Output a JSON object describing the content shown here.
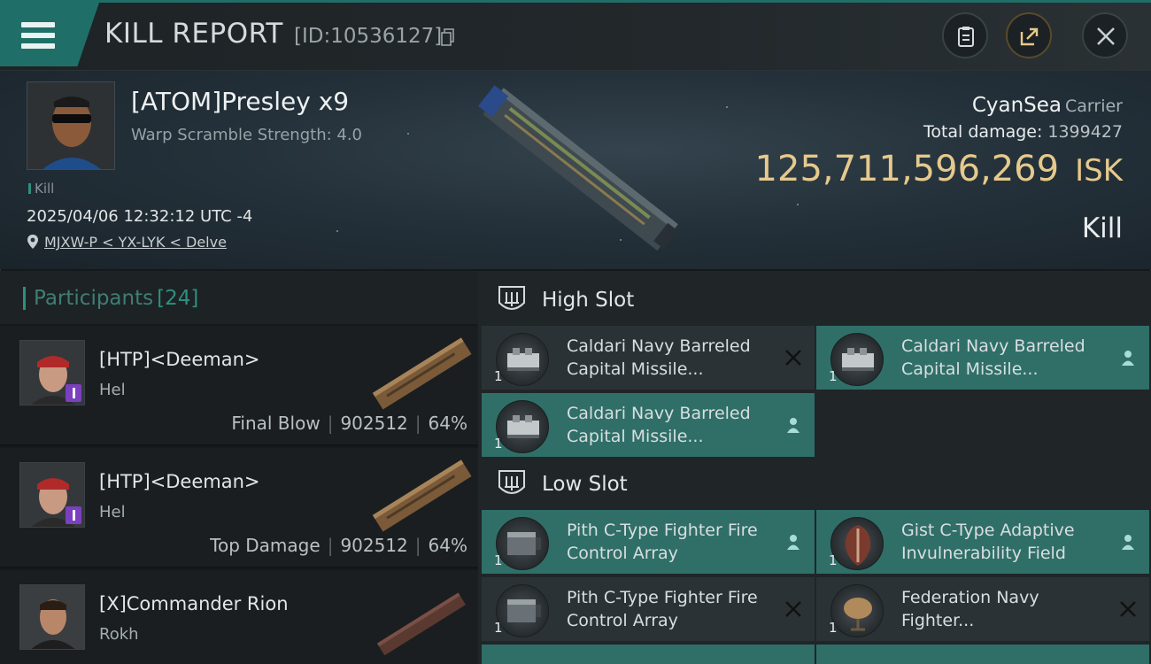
{
  "topbar": {
    "title": "KILL REPORT",
    "report_id": "[ID:10536127]"
  },
  "victim": {
    "name": "[ATOM]Presley x9",
    "warp_scramble": "Warp Scramble Strength: 4.0",
    "tag": "Kill",
    "datetime": "2025/04/06 12:32:12 UTC -4",
    "location": "MJXW-P < YX-LYK < Delve",
    "ship_name": "CyanSea",
    "ship_class": "Carrier",
    "total_damage_label": "Total damage:",
    "total_damage_value": "1399427",
    "isk_value": "125,711,596,269",
    "isk_unit": "ISK",
    "result": "Kill"
  },
  "participants": {
    "title": "Participants",
    "count": "[24]",
    "rows": [
      {
        "name": "[HTP]<Deeman>",
        "ship": "Hel",
        "role": "Final Blow",
        "damage": "902512",
        "percent": "64%"
      },
      {
        "name": "[HTP]<Deeman>",
        "ship": "Hel",
        "role": "Top Damage",
        "damage": "902512",
        "percent": "64%"
      },
      {
        "name": "[X]Commander Rion",
        "ship": "Rokh",
        "role": "",
        "damage": "",
        "percent": ""
      }
    ]
  },
  "slots": {
    "high": {
      "title": "High Slot",
      "modules": [
        {
          "name": "Caldari Navy Barreled Capital Missile...",
          "qty": "1",
          "status": "destroyed"
        },
        {
          "name": "Caldari Navy Barreled Capital Missile...",
          "qty": "1",
          "status": "dropped"
        },
        {
          "name": "Caldari Navy Barreled Capital Missile...",
          "qty": "1",
          "status": "dropped"
        }
      ]
    },
    "low": {
      "title": "Low Slot",
      "modules": [
        {
          "name": "Pith C-Type Fighter Fire Control Array",
          "qty": "1",
          "status": "dropped"
        },
        {
          "name": "Gist C-Type Adaptive Invulnerability Field",
          "qty": "1",
          "status": "dropped"
        },
        {
          "name": "Pith C-Type Fighter Fire Control Array",
          "qty": "1",
          "status": "destroyed"
        },
        {
          "name": "Federation Navy Fighter...",
          "qty": "1",
          "status": "destroyed"
        }
      ]
    }
  },
  "colors": {
    "accent": "#1f6f68",
    "isk": "#e6c98c",
    "dropped_bg": "#2f6f68",
    "destroyed_bg": "#2b3235"
  }
}
